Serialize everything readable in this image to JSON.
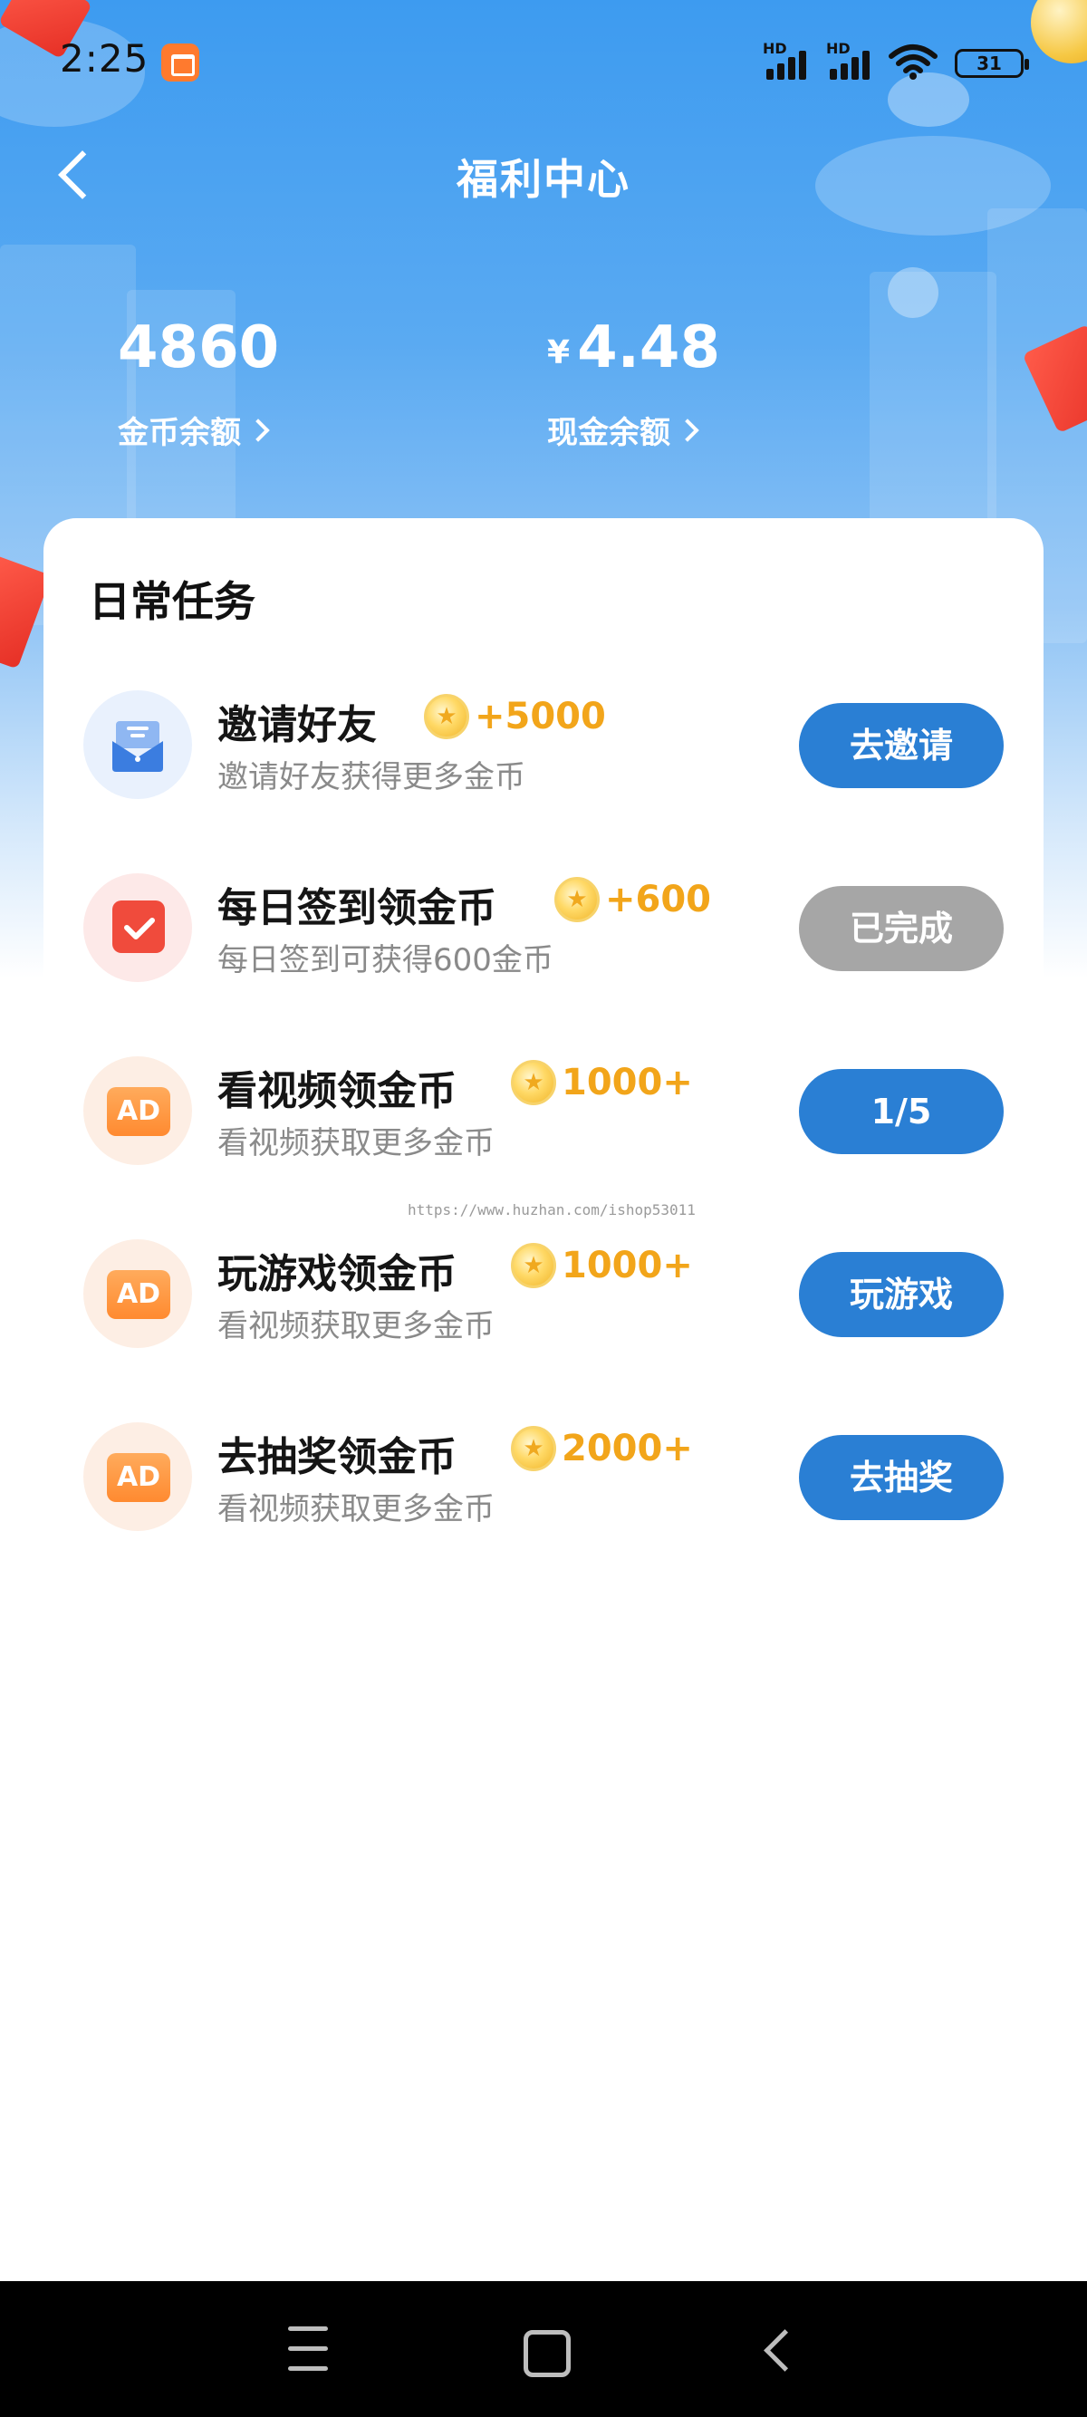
{
  "status_bar": {
    "time": "2:25",
    "network_left": "HD",
    "network_right": "HD",
    "battery": "31"
  },
  "header": {
    "title": "福利中心"
  },
  "balances": {
    "coins_value": "4860",
    "coins_label": "金币余额",
    "cash_currency": "¥",
    "cash_value": "4.48",
    "cash_label": "现金余额"
  },
  "tasks_section": {
    "title": "日常任务",
    "items": [
      {
        "name": "邀请好友",
        "reward": "+5000",
        "desc": "邀请好友获得更多金币",
        "button": "去邀请",
        "icon": "envelope-icon",
        "state": "active"
      },
      {
        "name": "每日签到领金币",
        "reward": "+600",
        "desc": "每日签到可获得600金币",
        "button": "已完成",
        "icon": "calendar-check-icon",
        "state": "done"
      },
      {
        "name": "看视频领金币",
        "reward": "1000+",
        "desc": "看视频获取更多金币",
        "button": "1/5",
        "icon": "ad-icon",
        "state": "active"
      },
      {
        "name": "玩游戏领金币",
        "reward": "1000+",
        "desc": "看视频获取更多金币",
        "button": "玩游戏",
        "icon": "ad-icon",
        "state": "active"
      },
      {
        "name": "去抽奖领金币",
        "reward": "2000+",
        "desc": "看视频获取更多金币",
        "button": "去抽奖",
        "icon": "ad-icon",
        "state": "active"
      }
    ]
  },
  "watermark": "https://www.huzhan.com/ishop53011",
  "colors": {
    "primary_button": "#2a7fd4",
    "done_button": "#a6a6a6",
    "reward_text": "#f2a51a",
    "header_gradient_top": "#3d9bf0"
  }
}
